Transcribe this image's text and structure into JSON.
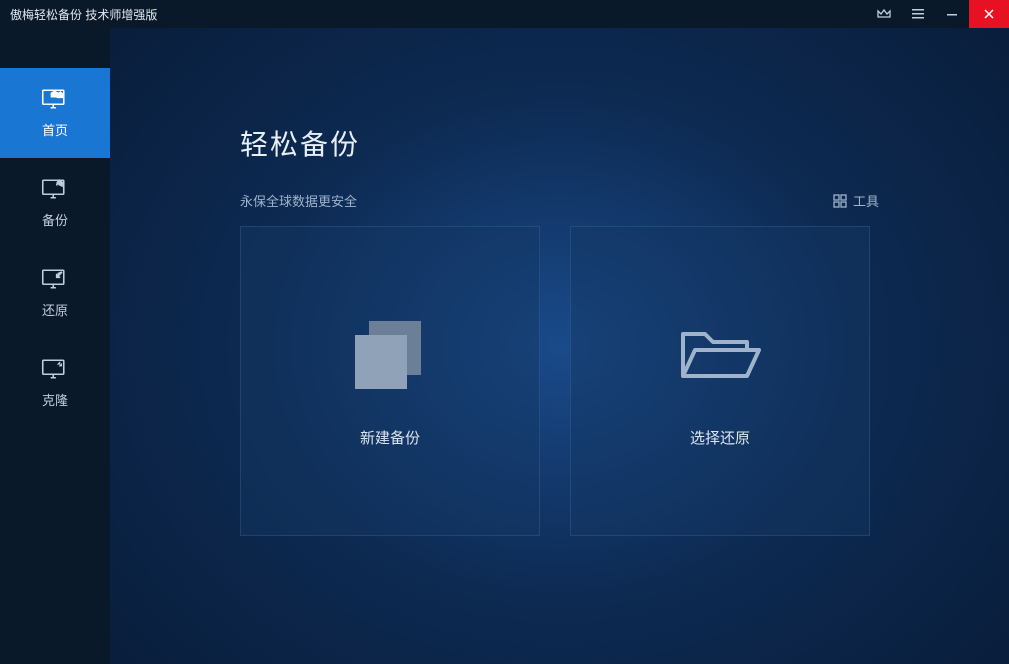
{
  "titlebar": {
    "title": "傲梅轻松备份 技术师增强版"
  },
  "sidebar": {
    "items": [
      {
        "label": "首页"
      },
      {
        "label": "备份"
      },
      {
        "label": "还原"
      },
      {
        "label": "克隆"
      }
    ]
  },
  "main": {
    "hero_title": "轻松备份",
    "subtitle": "永保全球数据更安全",
    "tools_label": "工具",
    "cards": [
      {
        "label": "新建备份"
      },
      {
        "label": "选择还原"
      }
    ]
  }
}
